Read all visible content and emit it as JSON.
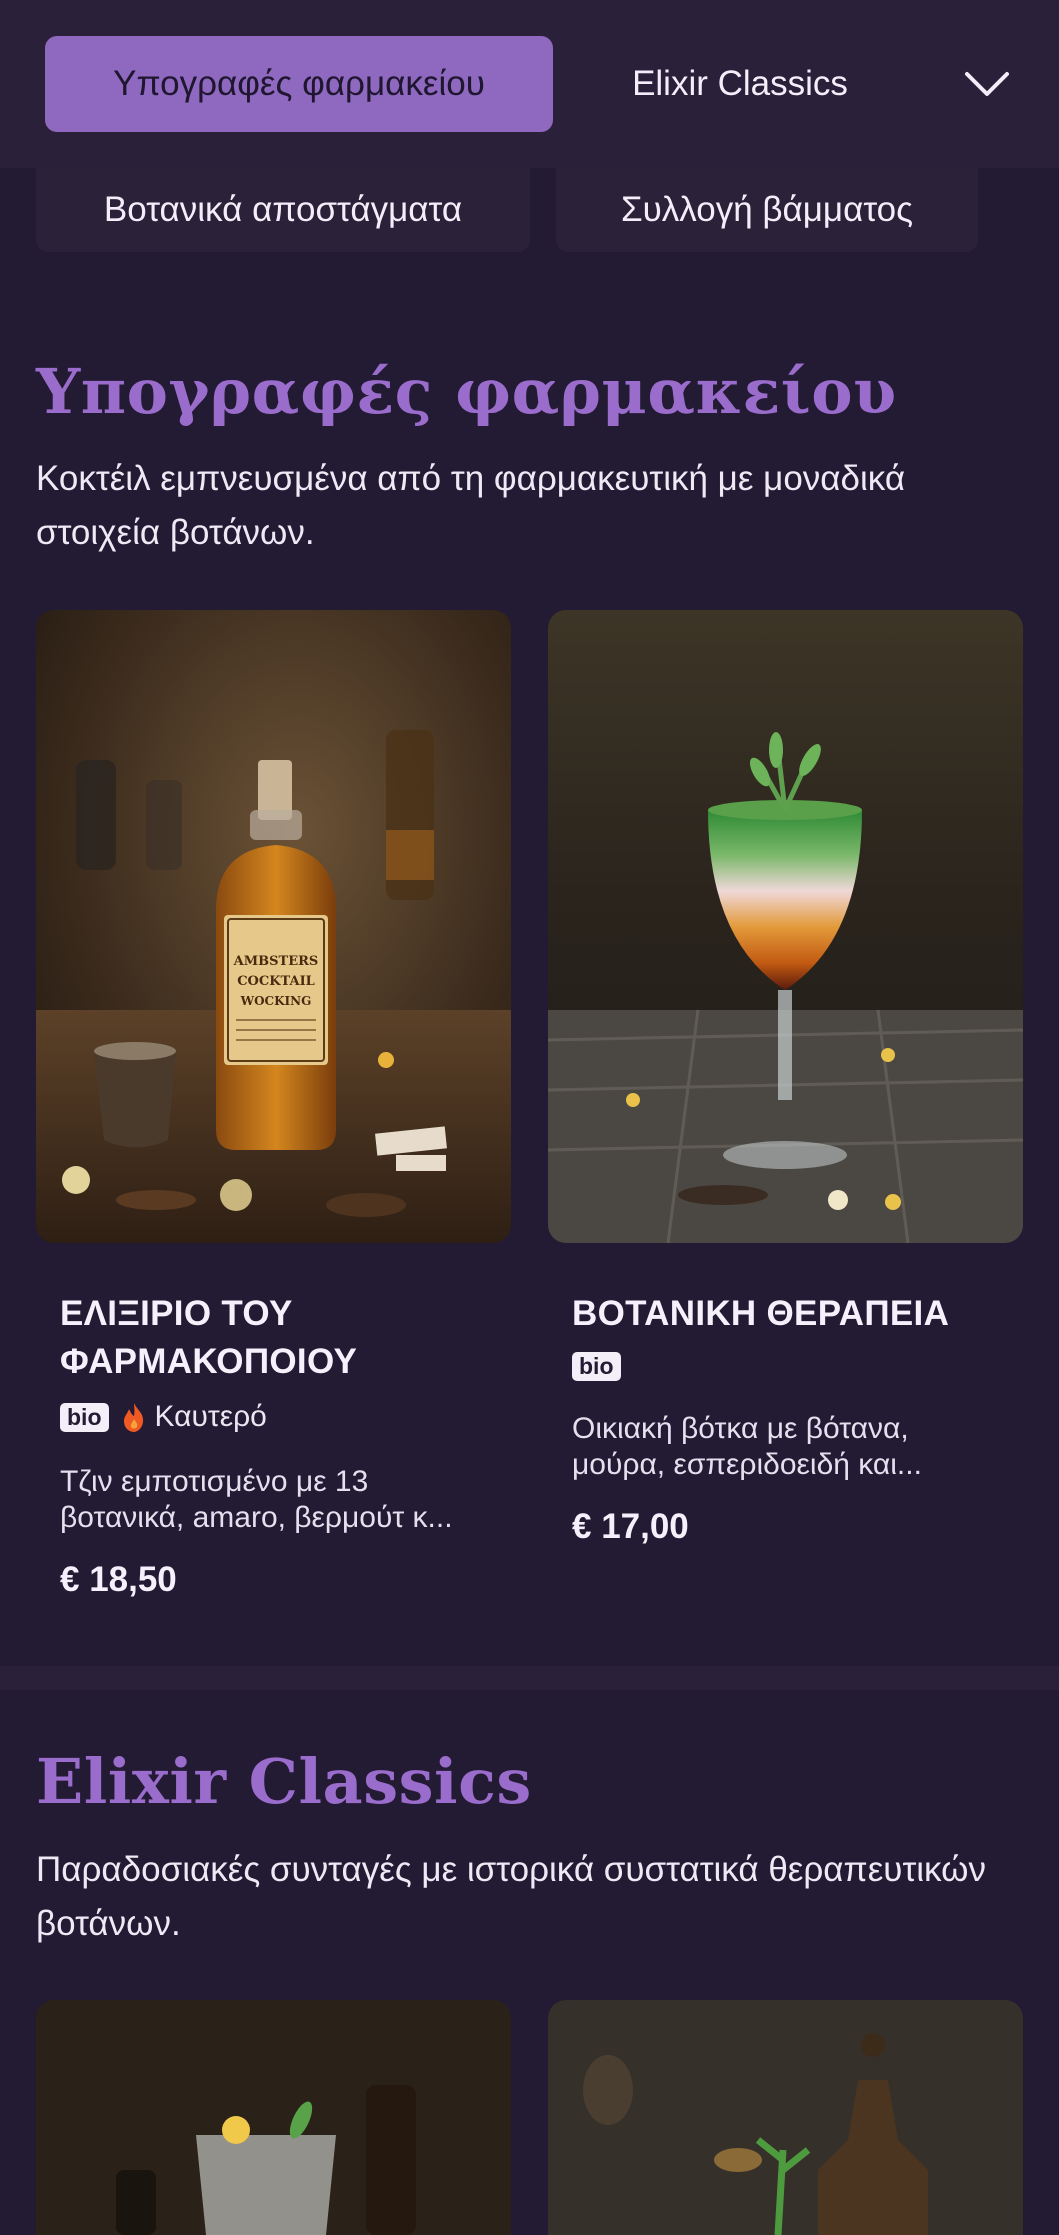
{
  "categories": {
    "active": "Υπογραφές φαρμακείου",
    "tab2": "Elixir Classics",
    "row2": [
      "Βοτανικά αποστάγματα",
      "Συλλογή βάμματος"
    ]
  },
  "sections": [
    {
      "title": "Υπογραφές φαρμακείου",
      "description": "Κοκτέιλ εμπνευσμένα από τη φαρμακευτική με μοναδικά στοιχεία βοτάνων.",
      "items": [
        {
          "name": "ΕΛΙΞΙΡΙΟ ΤΟΥ ΦΑΡΜΑΚΟΠΟΙΟΥ",
          "badge": "bio",
          "hot_label": "Καυτερό",
          "description": "Τζιν εμποτισμένο με 13 βοτανικά, amaro, βερμούτ κ...",
          "price": "€ 18,50",
          "image_label": "AMBSTERS COCKTAIL WOCKING"
        },
        {
          "name": "ΒΟΤΑΝΙΚΗ ΘΕΡΑΠΕΙΑ",
          "badge": "bio",
          "description": "Οικιακή βότκα με βότανα, μούρα, εσπεριδοειδή και...",
          "price": "€ 17,00"
        }
      ]
    },
    {
      "title": "Elixir Classics",
      "description": "Παραδοσιακές συνταγές με ιστορικά συστατικά θεραπευτικών βοτάνων."
    }
  ],
  "icons": [
    "chevron-down-icon",
    "flame-icon"
  ],
  "colors": {
    "background": "#231a33",
    "accent": "#8f68bf",
    "title": "#9a6ccb"
  }
}
